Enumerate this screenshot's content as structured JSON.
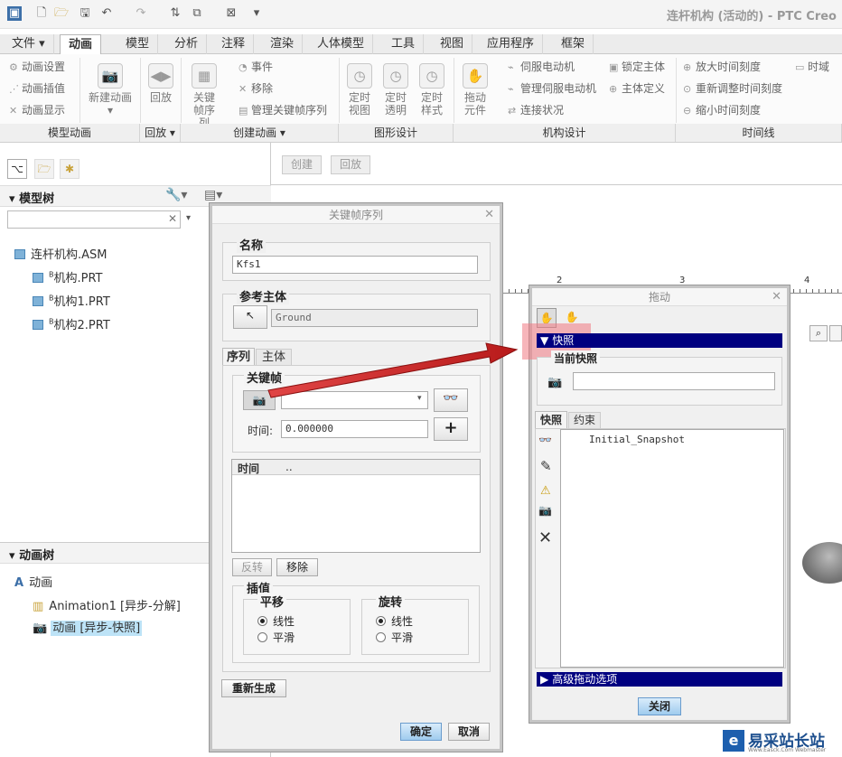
{
  "app": {
    "title": "连杆机构 (活动的) - PTC Creo"
  },
  "tabs": [
    "文件",
    "动画",
    "模型",
    "分析",
    "注释",
    "渲染",
    "人体模型",
    "工具",
    "视图",
    "应用程序",
    "框架"
  ],
  "ribbon": {
    "small_left": [
      "动画设置",
      "动画插值",
      "动画显示"
    ],
    "new_anim": "新建动画",
    "playback": "回放",
    "keyframe_seq": "关键帧序列",
    "event": "事件",
    "remove": "移除",
    "manage_kf": "管理关键帧序列",
    "timed_view": "定时视图",
    "timed_trans": "定时透明",
    "timed_style": "定时样式",
    "drag": "拖动元件",
    "servo": "伺服电动机",
    "manage_servo": "管理伺服电动机",
    "conn_status": "连接状况",
    "lock_body": "锁定主体",
    "body_def": "主体定义",
    "zoom_in_time": "放大时间刻度",
    "readjust_time": "重新调整时间刻度",
    "zoom_out_time": "缩小时间刻度",
    "timeline_btn": "时域",
    "groups": [
      "模型动画",
      "回放",
      "创建动画",
      "图形设计",
      "机构设计",
      "时间线"
    ]
  },
  "subbar": {
    "create": "创建",
    "playback": "回放"
  },
  "model_tree": {
    "header": "模型树",
    "items": [
      "连杆机构.ASM",
      "机构.PRT",
      "机构1.PRT",
      "机构2.PRT"
    ]
  },
  "anim_tree": {
    "header": "动画树",
    "items": [
      "动画",
      "Animation1 [异步-分解]",
      "动画 [异步-快照]"
    ]
  },
  "ruler_ticks": [
    "2",
    "3",
    "4"
  ],
  "kf_dialog": {
    "title": "关键帧序列",
    "name_label": "名称",
    "name_value": "Kfs1",
    "ref_label": "参考主体",
    "ref_value": "Ground",
    "tab_seq": "序列",
    "tab_body": "主体",
    "keyframe_label": "关键帧",
    "time_label": "时间:",
    "time_value": "0.000000",
    "table_col1": "时间",
    "table_col2": "..",
    "reverse": "反转",
    "remove": "移除",
    "interp_label": "插值",
    "translate": "平移",
    "rotate": "旋转",
    "linear": "线性",
    "smooth": "平滑",
    "regen": "重新生成",
    "ok": "确定",
    "cancel": "取消"
  },
  "drag_dialog": {
    "title": "拖动",
    "snapshot_section": "快照",
    "current_snapshot": "当前快照",
    "tab_snap": "快照",
    "tab_constraint": "约束",
    "list": [
      "Initial_Snapshot"
    ],
    "advanced": "高级拖动选项",
    "close": "关闭"
  },
  "watermark": {
    "text": "易采站长站",
    "sub": "Www.Easck.Com Webmaster"
  },
  "colors": {
    "accent": "#000080",
    "arrow": "#d42a2a",
    "selection": "#bde3f7"
  }
}
